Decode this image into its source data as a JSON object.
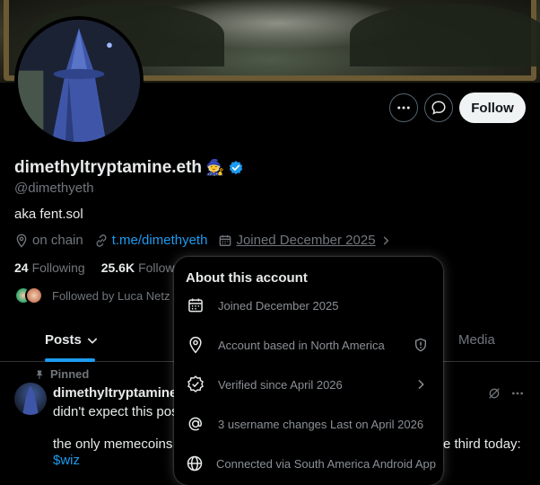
{
  "profile": {
    "display_name": "dimethyltryptamine.eth",
    "name_emoji": "🧙",
    "handle": "@dimethyeth",
    "bio": "aka fent.sol",
    "location": "on chain",
    "link": "t.me/dimethyeth",
    "joined": "Joined December 2025",
    "following_count": "24",
    "following_label": "Following",
    "followers_count": "25.6K",
    "followers_label": "Followe",
    "followed_by": "Followed by Luca Netz"
  },
  "actions": {
    "more_icon": "more-horizontal-icon",
    "message_icon": "message-icon",
    "follow_label": "Follow"
  },
  "tabs": [
    {
      "label": "Posts",
      "active": true
    },
    {
      "label": "Media",
      "active": false
    }
  ],
  "post": {
    "pinned_label": "Pinned",
    "author": "dimethyltryptamine",
    "line1": "didn't expect this pos",
    "line2_start": "the only memecoins I",
    "line2_end": "e third today:",
    "ticker": "$wiz"
  },
  "about": {
    "title": "About this account",
    "rows": [
      {
        "icon": "calendar-icon",
        "text": "Joined December 2025"
      },
      {
        "icon": "location-pin-icon",
        "text": "Account based in North America"
      },
      {
        "icon": "verified-badge-icon",
        "text": "Verified since April 2026"
      },
      {
        "icon": "at-sign-icon",
        "text": "3 username changes Last on April 2026"
      },
      {
        "icon": "globe-icon",
        "text": "Connected via South America Android App"
      }
    ]
  },
  "colors": {
    "accent": "#1d9bf0",
    "background": "#000000",
    "text_primary": "#e7e9ea",
    "text_secondary": "#71767b"
  }
}
